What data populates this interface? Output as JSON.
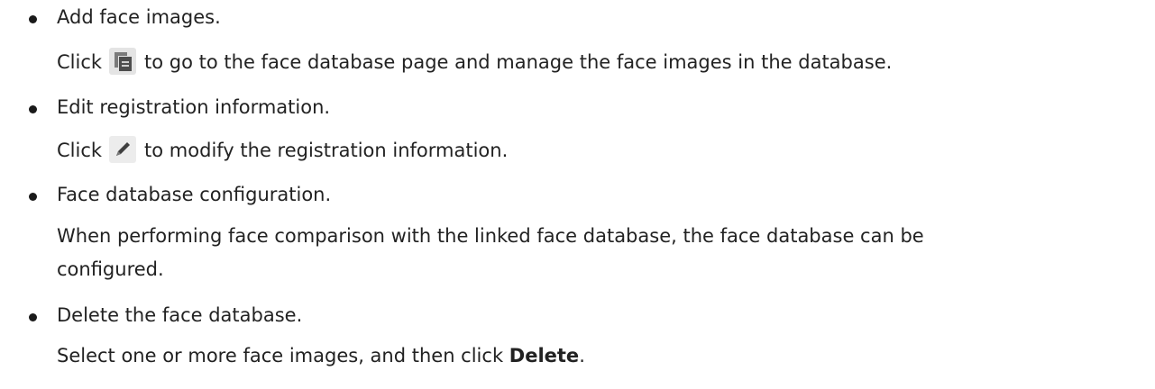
{
  "items": [
    {
      "title": "Add face images.",
      "desc_before_icon": "Click",
      "icon": "face-database-icon",
      "desc_after_icon": "to go to the face database page and manage the face images in the database."
    },
    {
      "title": "Edit registration information.",
      "desc_before_icon": "Click",
      "icon": "edit-pencil-icon",
      "desc_after_icon": "to modify the registration information."
    },
    {
      "title": "Face database configuration.",
      "desc_line1": "When performing face comparison with the linked face database, the face database can be",
      "desc_line2": "configured."
    },
    {
      "title": "Delete the face database.",
      "desc_before_bold": "Select one or more face images, and then click ",
      "desc_bold": "Delete",
      "desc_after_bold": "."
    }
  ],
  "colors": {
    "text": "#222222",
    "icon_background": "#e4e4e4",
    "icon_dark": "#4d4d4d"
  }
}
